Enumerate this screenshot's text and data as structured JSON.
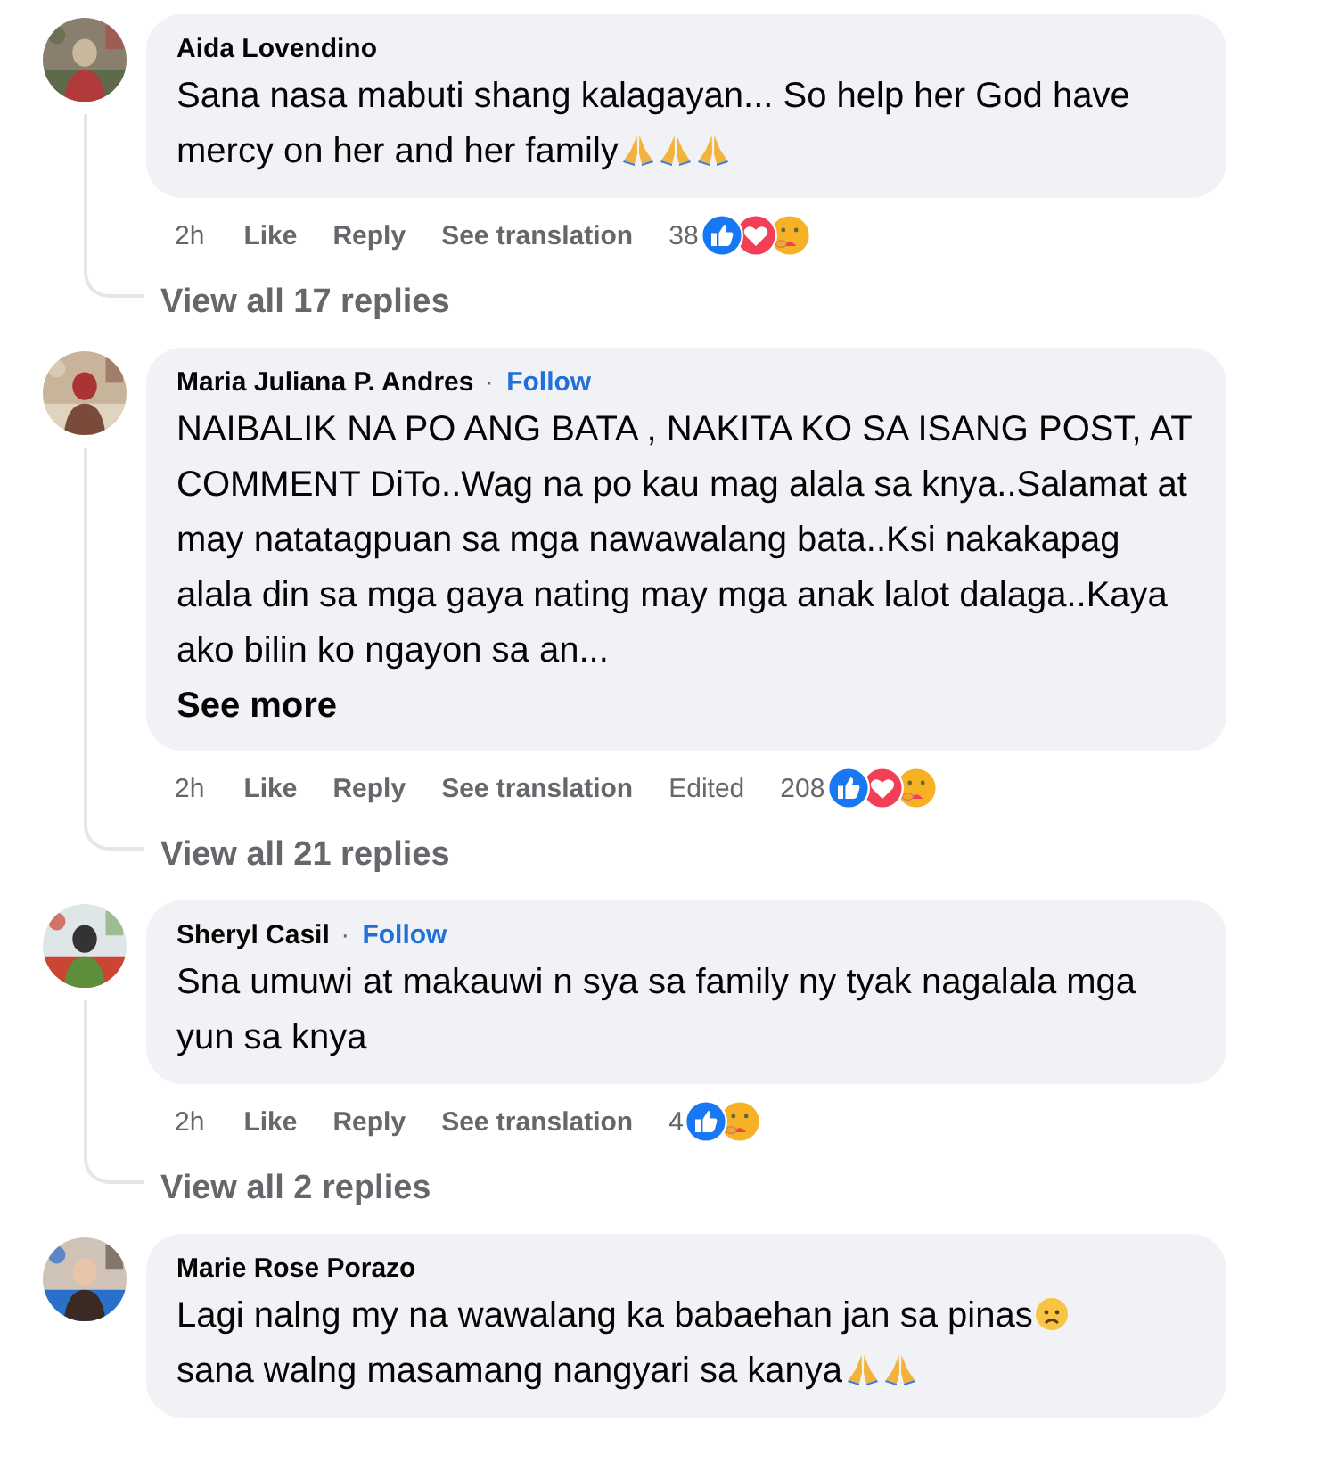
{
  "comments": [
    {
      "avatar": {
        "kind": "picture"
      },
      "name": "Aida Lovendino",
      "body": [
        {
          "kind": "text",
          "text": "Sana nasa mabuti shang kalagayan... So help her God have mercy on her and her family"
        },
        {
          "kind": "pray"
        },
        {
          "kind": "pray"
        },
        {
          "kind": "pray"
        }
      ],
      "time": "2h",
      "actions": [
        "Like",
        "Reply",
        "See translation"
      ],
      "count": "38",
      "reactions": [
        {
          "kind": "like"
        },
        {
          "kind": "love"
        },
        {
          "kind": "care"
        }
      ],
      "replies": "View all 17 replies"
    },
    {
      "avatar": {
        "kind": "picture"
      },
      "name": "Maria Juliana P. Andres",
      "follow": {
        "dot": "·",
        "label": "Follow"
      },
      "body": [
        {
          "kind": "text",
          "text": "NAIBALIK NA PO ANG BATA , NAKITA KO SA ISANG POST, AT COMMENT DiTo..Wag na po kau mag alala sa knya..Salamat at may natatagpuan sa mga nawawalang bata..Ksi nakakapag alala din sa mga gaya nating may mga anak lalot dalaga..Kaya ako bilin ko ngayon sa an..."
        }
      ],
      "see_more": "See more",
      "time": "2h",
      "actions": [
        "Like",
        "Reply",
        "See translation"
      ],
      "edited": "Edited",
      "count": "208",
      "reactions": [
        {
          "kind": "like"
        },
        {
          "kind": "love"
        },
        {
          "kind": "care"
        }
      ],
      "replies": "View all 21 replies"
    },
    {
      "avatar": {
        "kind": "picture"
      },
      "name": "Sheryl Casil",
      "follow": {
        "dot": "·",
        "label": "Follow"
      },
      "body": [
        {
          "kind": "text",
          "text": "Sna umuwi at makauwi n sya sa family ny tyak nagalala mga yun sa knya"
        }
      ],
      "time": "2h",
      "actions": [
        "Like",
        "Reply",
        "See translation"
      ],
      "count": "4",
      "reactions": [
        {
          "kind": "like"
        },
        {
          "kind": "care"
        }
      ],
      "replies": "View all 2 replies"
    },
    {
      "avatar": {
        "kind": "picture"
      },
      "name": "Marie Rose Porazo",
      "body": [
        {
          "kind": "text",
          "text": "Lagi nalng my na wawalang ka babaehan jan sa pinas"
        },
        {
          "kind": "sad"
        },
        {
          "kind": "break"
        },
        {
          "kind": "text",
          "text": "sana walng masamang nangyari sa kanya"
        },
        {
          "kind": "pray"
        },
        {
          "kind": "pray"
        }
      ]
    }
  ]
}
